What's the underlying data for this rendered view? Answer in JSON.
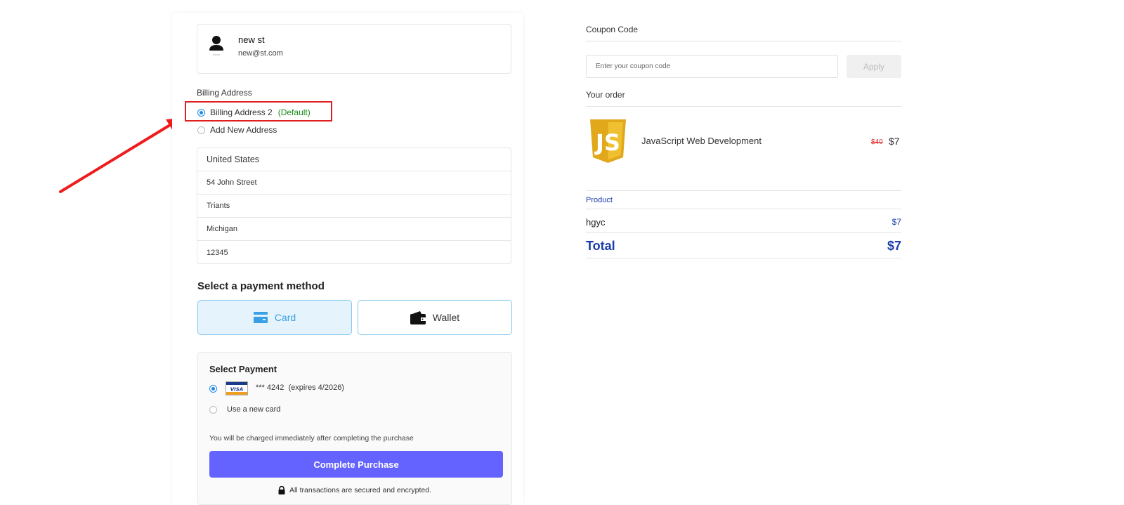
{
  "user": {
    "name": "new st",
    "email": "new@st.com"
  },
  "billing": {
    "label": "Billing Address",
    "options": [
      {
        "label": "Billing Address 2",
        "tag": "(Default)",
        "selected": true
      },
      {
        "label": "Add New Address",
        "selected": false
      }
    ],
    "address_rows": [
      "United States",
      "54 John Street",
      "Triants",
      "Michigan",
      "12345"
    ]
  },
  "payment_method": {
    "title": "Select a payment method",
    "options": [
      {
        "label": "Card",
        "icon": "card-icon",
        "selected": true
      },
      {
        "label": "Wallet",
        "icon": "wallet-icon",
        "selected": false
      }
    ]
  },
  "select_payment": {
    "title": "Select Payment",
    "saved_card": {
      "brand": "VISA",
      "text": "*** 4242  (expires 4/2026)",
      "selected": true
    },
    "new_card_label": "Use a new card",
    "charge_note": "You will be charged immediately after completing the purchase",
    "complete_button": "Complete Purchase",
    "secure_note": "All transactions are secured and encrypted."
  },
  "coupon": {
    "label": "Coupon Code",
    "placeholder": "Enter your coupon code",
    "apply_label": "Apply"
  },
  "order": {
    "label": "Your order",
    "item": {
      "logo_text": "JS",
      "name": "JavaScript Web Development",
      "old_price": "$40",
      "price": "$7"
    },
    "product_header": "Product",
    "product": {
      "name": "hgyc",
      "price": "$7"
    },
    "total_label": "Total",
    "total_value": "$7"
  },
  "colors": {
    "accent_blue": "#1e88e5",
    "highlight_red": "#e02020",
    "purchase_button": "#6563ff",
    "total_text": "#1a3da8",
    "default_tag": "#1a8a1a"
  }
}
